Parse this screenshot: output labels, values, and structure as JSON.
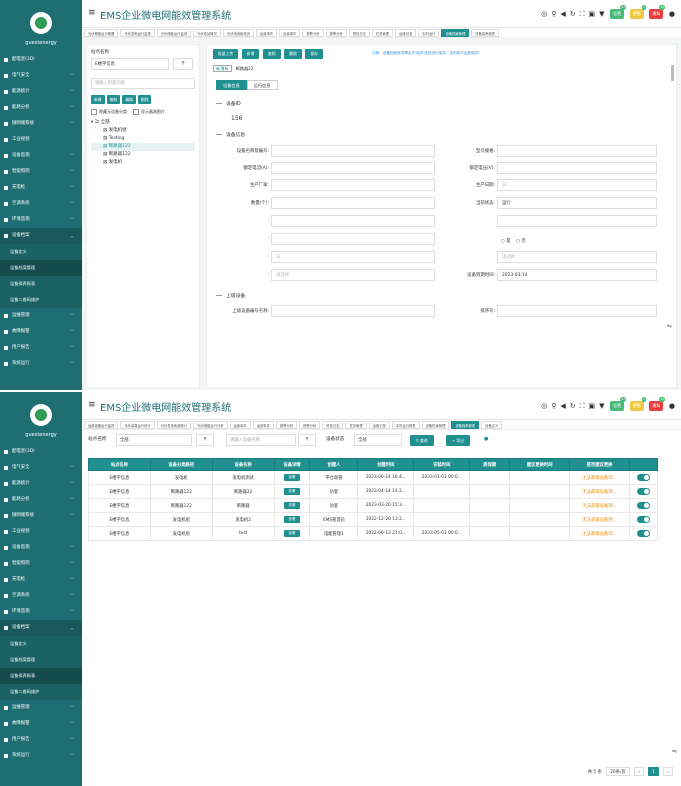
{
  "app_title": "EMS企业微电网能效管理系统",
  "username": "guestenergy",
  "colors": {
    "accent": "#1f8f90",
    "sidebar": "#1f6f72",
    "warn": "#e68a00"
  },
  "top_icons": [
    "clock-icon",
    "search-icon",
    "volume-icon",
    "refresh-icon",
    "fullscreen-icon",
    "image-icon",
    "shirt-icon"
  ],
  "badges": [
    {
      "label": "告警",
      "count": "47",
      "color": "#48bb78"
    },
    {
      "label": "预警",
      "count": "0",
      "color": "#ecc94b"
    },
    {
      "label": "通知",
      "count": "12",
      "color": "#e53e3e"
    }
  ],
  "menu1": [
    {
      "label": "配电室(3D)",
      "arrow": ""
    },
    {
      "label": "电气安全",
      "arrow": "﹀"
    },
    {
      "label": "能源统计",
      "arrow": "﹀"
    },
    {
      "label": "能耗分析",
      "arrow": "﹀"
    },
    {
      "label": "微网储系统",
      "arrow": "﹀"
    },
    {
      "label": "工业视频",
      "arrow": ""
    },
    {
      "label": "设备监测",
      "arrow": "﹀"
    },
    {
      "label": "智能照明",
      "arrow": "﹀"
    },
    {
      "label": "充电桩",
      "arrow": "﹀"
    },
    {
      "label": "空调系统",
      "arrow": "﹀"
    },
    {
      "label": "环境监测",
      "arrow": "﹀"
    },
    {
      "label": "设备档案",
      "arrow": "︿"
    }
  ],
  "submenu1": [
    "设备定义",
    "设备档案管理",
    "设备保养报表",
    "设备二维码维护"
  ],
  "menu1_after": [
    {
      "label": "运维管理",
      "arrow": "﹀"
    },
    {
      "label": "故障报警",
      "arrow": "﹀"
    },
    {
      "label": "用户报告",
      "arrow": "﹀"
    },
    {
      "label": "系统运行",
      "arrow": "﹀"
    }
  ],
  "tabs1": [
    "光伏储能运行概要",
    "光伏发电运行监视",
    "光伏储能运行监测",
    "光伏电站概况",
    "光伏电池板电流",
    "运营事件",
    "运营事件",
    "报警分析",
    "报警分析",
    "短信日志",
    "任务管理",
    "运维记录",
    "实时运行",
    "设备档案管理",
    "设备保养报表"
  ],
  "tabs2": [
    "运维装备运行监视",
    "光伏装置运行统计",
    "光伏发电电源统计",
    "光伏储能运行分析",
    "运营事件",
    "运营事件",
    "报警分析",
    "报警分析",
    "短信日志",
    "任务管理",
    "运维记录",
    "实时运行报表",
    "设备档案管理",
    "设备保养报表",
    "设备定义"
  ],
  "page1": {
    "site_label": "站点名称",
    "site_value": "E楼宇信息",
    "search_placeholder": "请输入检索内容",
    "tree_buttons": [
      "新增",
      "复制",
      "编辑",
      "删除"
    ],
    "check_hide": "隐藏无设备分类",
    "check_img": "显示器具图片",
    "tree": [
      "全部",
      "发电机组",
      "Testing",
      "断路器122",
      "断路器122",
      "发电机"
    ],
    "toolbar": [
      "批量上传",
      "新增",
      "复制",
      "删除",
      "保存"
    ],
    "note": "注释：设备档案修改需点击'保存'按钮进行保存，否则将不会被保存!",
    "crumb_first": "新增板",
    "crumb_second": "断路器22",
    "subtabs": [
      "设备信息",
      "运行信息"
    ],
    "sec_id": "设备ID",
    "device_id": "156",
    "sec_info": "设备信息",
    "left_fields": [
      "设备名称及编号:",
      "额定电流(A):",
      "生产厂家:",
      "数量(个):",
      "",
      "",
      "",
      "",
      ""
    ],
    "right_fields": [
      {
        "label": "型号规格:",
        "value": ""
      },
      {
        "label": "额定电压(V):",
        "value": ""
      },
      {
        "label": "生产日期:",
        "value": "日"
      },
      {
        "label": "当前状态:",
        "value": "运行"
      },
      {
        "label": "",
        "value": ""
      },
      {
        "label": "",
        "value": ""
      },
      {
        "label": "",
        "value": "请选择"
      },
      {
        "label": "设备到期时间:",
        "value": "2023-03-14"
      }
    ],
    "radio_yes": "是",
    "radio_no": "否",
    "left_placeholders": [
      "",
      "",
      "",
      "",
      "",
      "",
      "日",
      "请选择"
    ],
    "sec_parent": "上级设备",
    "parent_label": "上级设备编号名称:",
    "sort_label": "排序号:"
  },
  "menu2": [
    {
      "label": "配电室(3D)",
      "arrow": ""
    },
    {
      "label": "电气安全",
      "arrow": "﹀"
    },
    {
      "label": "能源统计",
      "arrow": "﹀"
    },
    {
      "label": "能耗分析",
      "arrow": "﹀"
    },
    {
      "label": "微网储系统",
      "arrow": "﹀"
    },
    {
      "label": "工业视频",
      "arrow": ""
    },
    {
      "label": "设备监测",
      "arrow": "﹀"
    },
    {
      "label": "智能照明",
      "arrow": "﹀"
    },
    {
      "label": "充电桩",
      "arrow": "﹀"
    },
    {
      "label": "空调系统",
      "arrow": "﹀"
    },
    {
      "label": "环境监测",
      "arrow": "﹀"
    },
    {
      "label": "设备档案",
      "arrow": "︿"
    }
  ],
  "submenu2": [
    "设备定义",
    "设备档案管理",
    "设备保养报表",
    "设备二维码维护"
  ],
  "menu2_after": [
    {
      "label": "运维管理",
      "arrow": "﹀"
    },
    {
      "label": "故障报警",
      "arrow": "﹀"
    },
    {
      "label": "用户报告",
      "arrow": "﹀"
    },
    {
      "label": "系统运行",
      "arrow": "﹀"
    }
  ],
  "page2": {
    "site_label": "站点名称",
    "site_value": "全部",
    "name_placeholder": "请输入设备名称",
    "status_label": "设备状态",
    "status_value": "全部",
    "query_btn": "查询",
    "export_btn": "导出",
    "columns": [
      "站点名称",
      "设备分类路径",
      "设备名称",
      "设备详情",
      "创建人",
      "创建时间",
      "安装时间",
      "质保期",
      "建议更换时间",
      "是否建议更换",
      ""
    ],
    "rows": [
      [
        "E楼宇信息",
        "发电机",
        "发电机测试",
        "查看",
        "平仓雨管",
        "2023-06-14 16:4...",
        "2023-01-01 00:0...",
        "",
        "",
        "无法获取设备到..."
      ],
      [
        "E楼宇信息",
        "断路器122",
        "断路器22",
        "查看",
        "访客",
        "2023-04-14 14:2...",
        "",
        "",
        "",
        "无法获取设备到..."
      ],
      [
        "E楼宇信息",
        "断路器122",
        "断路器",
        "查看",
        "访客",
        "2023-03-20 15:3...",
        "",
        "",
        "",
        "无法获取设备到..."
      ],
      [
        "E楼宇信息",
        "发电机组",
        "发电机2",
        "查看",
        "EMS管理员",
        "2022-12-20 13:2...",
        "",
        "",
        "",
        "无法获取设备到..."
      ],
      [
        "E楼宇信息",
        "发电机组",
        "test",
        "查看",
        "电能管理1",
        "2022-06-13 21:0...",
        "2023-05-01 00:0...",
        "",
        "",
        "无法获取设备到..."
      ]
    ],
    "total": "共 5 条",
    "page_size": "20条/页",
    "page": "1"
  }
}
